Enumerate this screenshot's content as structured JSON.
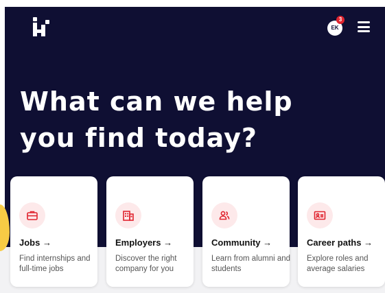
{
  "colors": {
    "hero_background": "#0f0f33",
    "accent_red": "#e0242f",
    "icon_circle_bg": "#fde9ea"
  },
  "header": {
    "logo_icon": "handshake-logo-icon",
    "avatar_initials": "EK",
    "notification_count": "3",
    "menu_icon": "hamburger-menu-icon"
  },
  "hero": {
    "headline_line1": "What can we help",
    "headline_line2": "you find today?"
  },
  "cards": [
    {
      "title": "Jobs",
      "arrow": "→",
      "desc": "Find internships and full-time jobs",
      "icon": "briefcase-icon"
    },
    {
      "title": "Employers",
      "arrow": "→",
      "desc": "Discover the right company for you",
      "icon": "building-icon"
    },
    {
      "title": "Community",
      "arrow": "→",
      "desc": "Learn from alumni and students",
      "icon": "people-icon"
    },
    {
      "title": "Career paths",
      "arrow": "→",
      "desc": "Explore roles and average salaries",
      "icon": "id-card-icon"
    }
  ]
}
